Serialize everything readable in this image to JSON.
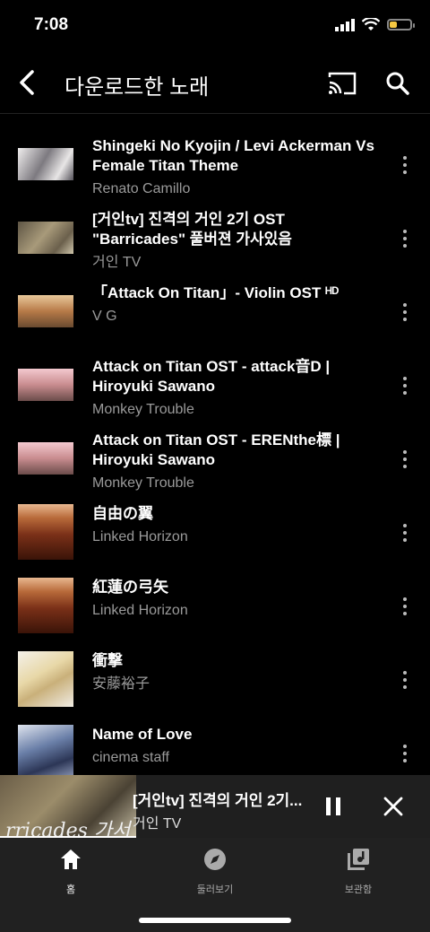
{
  "status_bar": {
    "time": "7:08"
  },
  "header": {
    "title": "다운로드한 노래"
  },
  "tracks": [
    {
      "title": "Shingeki No Kyojin / Levi Ackerman Vs Female Titan Theme",
      "artist": "Renato Camillo",
      "thumb_color": "#d9d4d0"
    },
    {
      "title": "[거인tv] 진격의 거인 2기 OST \"Barricades\" 풀버젼 가사있음",
      "artist": "거인 TV",
      "thumb_color": "#8b7a5a"
    },
    {
      "title": "「Attack On Titan」- Violin OST ᴴᴰ",
      "artist": "V G",
      "thumb_color": "#b9875a"
    },
    {
      "title": "Attack on Titan OST - attack音D | Hiroyuki Sawano",
      "artist": "Monkey Trouble",
      "thumb_color": "#c68b8f"
    },
    {
      "title": "Attack on Titan OST - ERENthe標 | Hiroyuki Sawano",
      "artist": "Monkey Trouble",
      "thumb_color": "#c68b8f"
    },
    {
      "title": "自由の翼",
      "artist": "Linked Horizon",
      "thumb_color": "#8e3b1e"
    },
    {
      "title": "紅蓮の弓矢",
      "artist": "Linked Horizon",
      "thumb_color": "#8e3b1e"
    },
    {
      "title": "衝撃",
      "artist": "安藤裕子",
      "thumb_color": "#e8e2d0"
    },
    {
      "title": "Name of Love",
      "artist": "cinema staff",
      "thumb_color": "#5a6b8a"
    }
  ],
  "mini_player": {
    "title": "[거인tv] 진격의 거인 2기...",
    "artist": "거인 TV",
    "art_text": "rricades 가서"
  },
  "nav": [
    {
      "label": "홈"
    },
    {
      "label": "둘러보기"
    },
    {
      "label": "보관함"
    }
  ]
}
